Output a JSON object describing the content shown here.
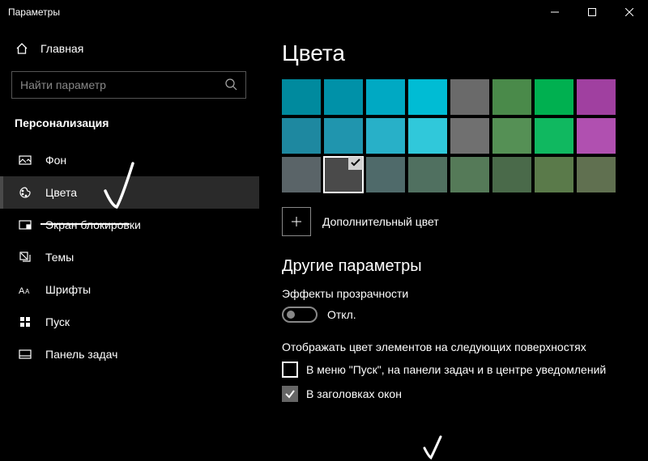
{
  "window": {
    "title": "Параметры"
  },
  "home": {
    "label": "Главная"
  },
  "search": {
    "placeholder": "Найти параметр"
  },
  "section": {
    "title": "Персонализация"
  },
  "nav": [
    {
      "id": "background",
      "label": "Фон"
    },
    {
      "id": "colors",
      "label": "Цвета"
    },
    {
      "id": "lockscreen",
      "label": "Экран блокировки"
    },
    {
      "id": "themes",
      "label": "Темы"
    },
    {
      "id": "fonts",
      "label": "Шрифты"
    },
    {
      "id": "start",
      "label": "Пуск"
    },
    {
      "id": "taskbar",
      "label": "Панель задач"
    }
  ],
  "page": {
    "heading": "Цвета",
    "custom_color": "Дополнительный цвет",
    "other_params": "Другие параметры",
    "transparency_label": "Эффекты прозрачности",
    "transparency_value": "Откл.",
    "surfaces_label": "Отображать цвет элементов на следующих поверхностях",
    "cb_start": "В меню \"Пуск\", на панели задач и в центре уведомлений",
    "cb_titles": "В заголовках окон"
  },
  "palette": [
    [
      "#008a9e",
      "#0091a8",
      "#00a9c3",
      "#00bcd4",
      "#6a6a6a",
      "#4a8a4a",
      "#00b050",
      "#a040a0"
    ],
    [
      "#1e88a0",
      "#2095ae",
      "#28b0c8",
      "#30c8da",
      "#707070",
      "#559055",
      "#10b860",
      "#b050b0"
    ],
    [
      "#5a6468",
      "#4a4a4a",
      "#4f6a6a",
      "#507060",
      "#557a58",
      "#4a6a4a",
      "#5a7a4a",
      "#607050"
    ]
  ],
  "selected_swatch": {
    "row": 2,
    "col": 1
  }
}
